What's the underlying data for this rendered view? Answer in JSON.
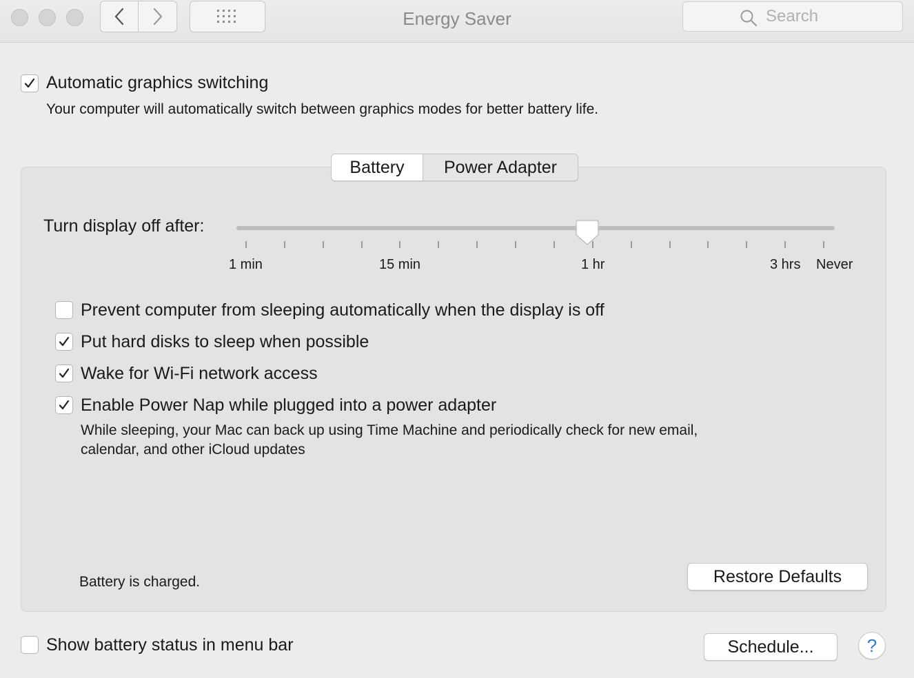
{
  "window": {
    "title": "Energy Saver",
    "search_placeholder": "Search"
  },
  "graphics_switching": {
    "label": "Automatic graphics switching",
    "checked": true,
    "description": "Your computer will automatically switch between graphics modes for better battery life."
  },
  "tabs": [
    {
      "label": "Battery",
      "active": true
    },
    {
      "label": "Power Adapter",
      "active": false
    }
  ],
  "display_sleep": {
    "label": "Turn display off after:",
    "value": "1 hr",
    "tick_labels": [
      "1 min",
      "15 min",
      "1 hr",
      "3 hrs",
      "Never"
    ]
  },
  "options": [
    {
      "label": "Prevent computer from sleeping automatically when the display is off",
      "checked": false
    },
    {
      "label": "Put hard disks to sleep when possible",
      "checked": true
    },
    {
      "label": "Wake for Wi-Fi network access",
      "checked": true
    },
    {
      "label": "Enable Power Nap while plugged into a power adapter",
      "checked": true
    }
  ],
  "power_nap_description": {
    "line1": "While sleeping, your Mac can back up using Time Machine and periodically check for new email,",
    "line2": "calendar, and other iCloud updates"
  },
  "battery_status": "Battery is charged.",
  "restore_defaults_label": "Restore Defaults",
  "show_battery_status": {
    "label": "Show battery status in menu bar",
    "checked": false
  },
  "schedule_label": "Schedule...",
  "help_label": "?",
  "colors": {
    "window_bg": "#ececec",
    "panel_bg": "#e3e3e3",
    "help_accent": "#2a7ae2"
  }
}
